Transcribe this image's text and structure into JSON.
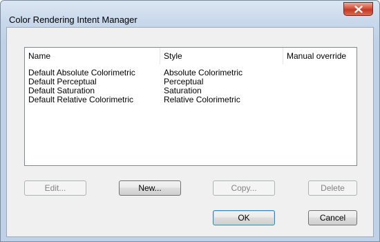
{
  "window": {
    "title": "Color Rendering Intent Manager",
    "close_icon": "close-icon"
  },
  "listview": {
    "columns": [
      "Name",
      "Style",
      "Manual override"
    ],
    "rows": [
      {
        "name": "Default Absolute Colorimetric",
        "style": "Absolute Colorimetric",
        "override": ""
      },
      {
        "name": "Default Perceptual",
        "style": "Perceptual",
        "override": ""
      },
      {
        "name": "Default Saturation",
        "style": "Saturation",
        "override": ""
      },
      {
        "name": "Default Relative Colorimetric",
        "style": "Relative Colorimetric",
        "override": ""
      }
    ]
  },
  "buttons": {
    "edit": "Edit...",
    "new": "New...",
    "copy": "Copy...",
    "delete": "Delete",
    "ok": "OK",
    "cancel": "Cancel"
  },
  "colors": {
    "close_button": "#c9462c",
    "title_bar": "#c9d9ec",
    "dialog_face": "#f0f0f0",
    "default_button_border": "#3c7fb1"
  }
}
